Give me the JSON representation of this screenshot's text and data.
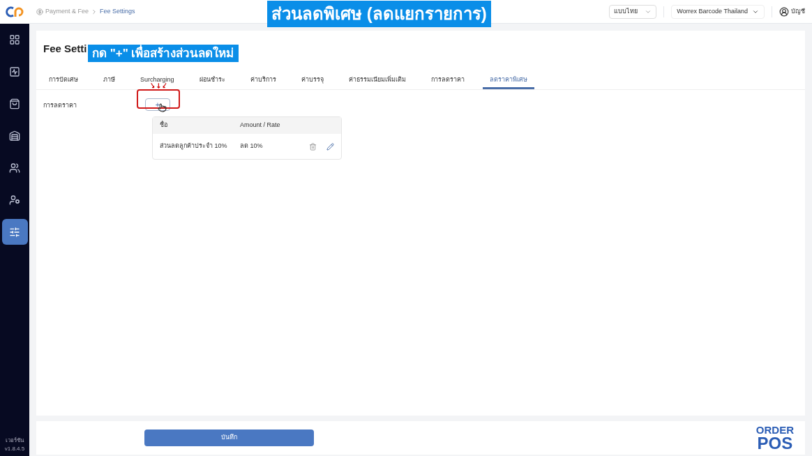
{
  "breadcrumb": [
    {
      "label": "Payment & Fee",
      "selected": false
    },
    {
      "label": "Fee Settings",
      "selected": true
    }
  ],
  "header": {
    "language": "แบบไทย",
    "store": "Worrex Barcode Thailand",
    "account": "บัญชี"
  },
  "sidebar": {
    "items": [
      {
        "selected": false
      },
      {
        "selected": false
      },
      {
        "selected": false
      },
      {
        "selected": false
      },
      {
        "selected": false
      },
      {
        "selected": false
      },
      {
        "selected": true
      }
    ],
    "version_label": "เวอร์ชัน",
    "version": "v1.8.4.5"
  },
  "page_title": "Fee Setti",
  "tabs": [
    {
      "label": "การปัดเศษ",
      "selected": false
    },
    {
      "label": "ภาษี",
      "selected": false
    },
    {
      "label": "Surcharging",
      "selected": false
    },
    {
      "label": "ผ่อนชำระ",
      "selected": false
    },
    {
      "label": "ค่าบริการ",
      "selected": false
    },
    {
      "label": "ค่าบรรจุ",
      "selected": false
    },
    {
      "label": "ค่าธรรมเนียมเพิ่มเติม",
      "selected": false
    },
    {
      "label": "การลดราคา",
      "selected": false
    },
    {
      "label": "ลดราคาพิเศษ",
      "selected": true
    }
  ],
  "section_label": "การลดราคา",
  "add_button": "+",
  "table": {
    "columns": [
      "ชื่อ",
      "Amount / Rate"
    ],
    "rows": [
      {
        "name": "ส่วนลดลูกค้าประจำ 10%",
        "amount": "ลด 10%"
      }
    ]
  },
  "save_button": "บันทึก",
  "captions": [
    "ส่วนลดพิเศษ (ลดแยกรายการ)",
    "กด \"+\" เพื่อสร้างส่วนลดใหม่"
  ],
  "brand": {
    "line1": "ORDER",
    "line2": "POS"
  }
}
